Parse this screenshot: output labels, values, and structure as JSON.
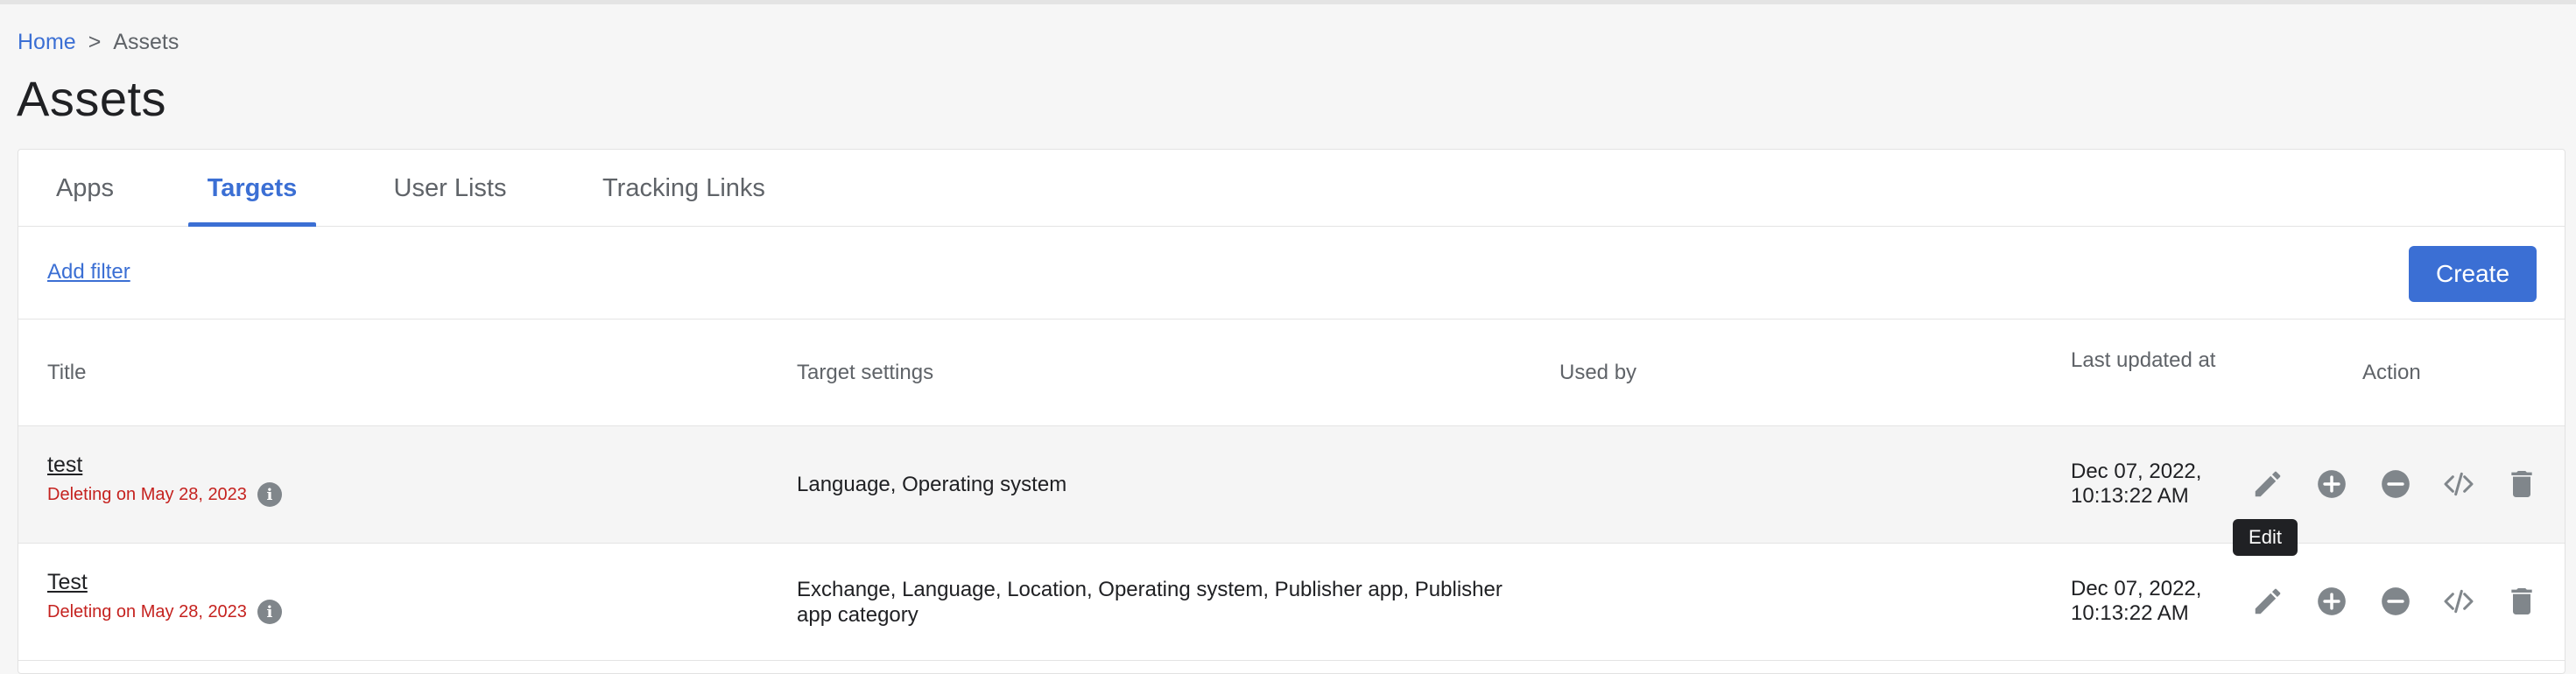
{
  "breadcrumb": {
    "home": "Home",
    "separator": ">",
    "current": "Assets"
  },
  "page": {
    "title": "Assets"
  },
  "tabs": [
    {
      "label": "Apps"
    },
    {
      "label": "Targets"
    },
    {
      "label": "User Lists"
    },
    {
      "label": "Tracking Links"
    }
  ],
  "active_tab": "Targets",
  "toolbar": {
    "add_filter": "Add filter",
    "create": "Create"
  },
  "table": {
    "columns": [
      "Title",
      "Target settings",
      "Used by",
      "Last updated at",
      "Action"
    ],
    "rows": [
      {
        "title": "test",
        "status": "Deleting on May 28, 2023",
        "settings": "Language, Operating system",
        "used_by": "",
        "updated_date": "Dec 07, 2022,",
        "updated_time": "10:13:22 AM"
      },
      {
        "title": "Test",
        "status": "Deleting on May 28, 2023",
        "settings": "Exchange, Language, Location, Operating system, Publisher app, Publisher app category",
        "used_by": "",
        "updated_date": "Dec 07, 2022,",
        "updated_time": "10:13:22 AM"
      }
    ],
    "action_icons": [
      "pencil-icon",
      "plus-circle-icon",
      "minus-circle-icon",
      "code-icon",
      "trash-icon"
    ]
  },
  "tooltip": {
    "text": "Edit"
  },
  "info_icon_glyph": "i",
  "colors": {
    "accent": "#3b6fd4",
    "danger": "#c5221f",
    "icon": "#80868b",
    "tooltip_bg": "#202124"
  }
}
